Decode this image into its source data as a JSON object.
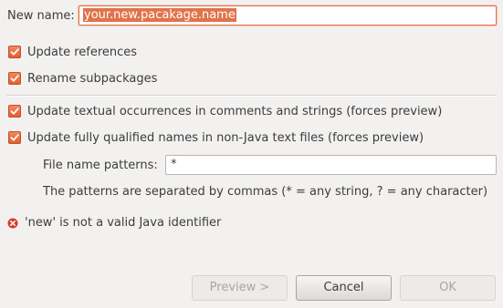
{
  "form": {
    "new_name_label": "New name:",
    "new_name_value": "your.new.pacakage.name"
  },
  "options": [
    {
      "label": "Update references",
      "checked": true
    },
    {
      "label": "Rename subpackages",
      "checked": true
    },
    {
      "label": "Update textual occurrences in comments and strings (forces preview)",
      "checked": true
    },
    {
      "label": "Update fully qualified names in non-Java text files (forces preview)",
      "checked": true
    }
  ],
  "patterns": {
    "label": "File name patterns:",
    "value": "*",
    "hint": "The patterns are separated by commas (* = any string, ? = any character)"
  },
  "error": {
    "icon": "error-icon",
    "message": "'new' is not a valid Java identifier",
    "color": "#d93a2b"
  },
  "buttons": {
    "preview": {
      "label": "Preview >",
      "enabled": false
    },
    "cancel": {
      "label": "Cancel",
      "enabled": true
    },
    "ok": {
      "label": "OK",
      "enabled": false
    }
  },
  "colors": {
    "accent": "#e0734a",
    "background": "#f2f1f0"
  }
}
